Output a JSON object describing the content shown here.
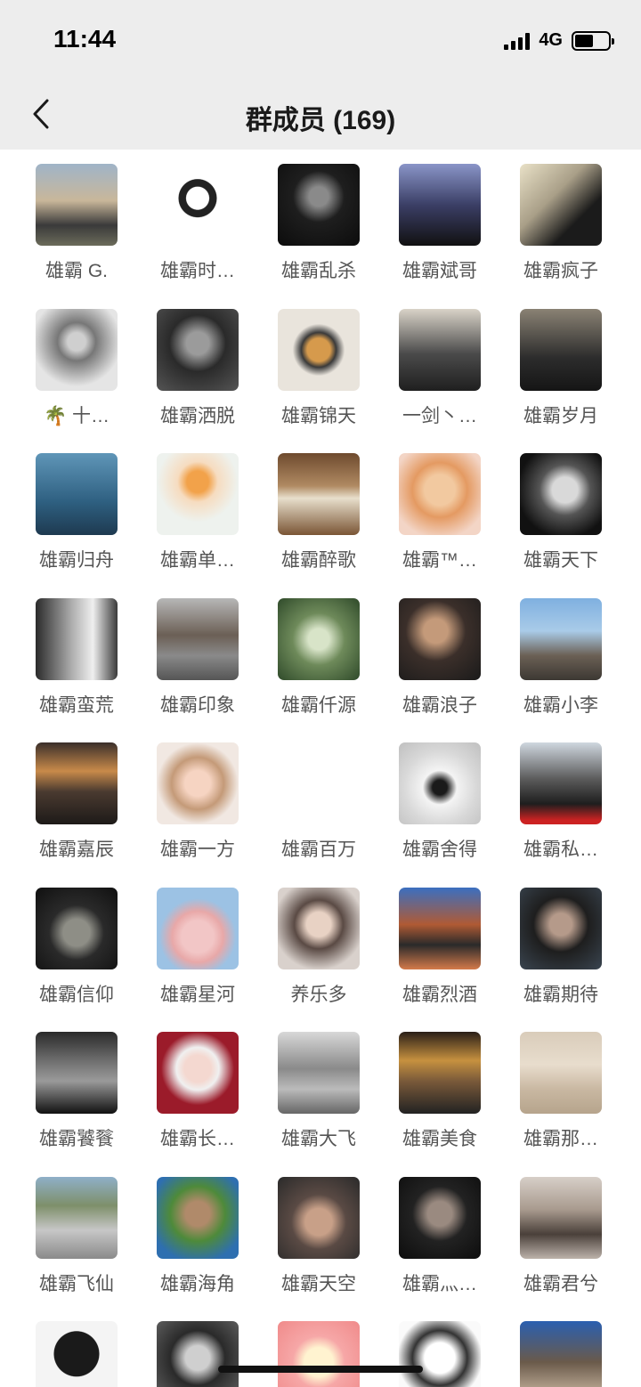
{
  "status_bar": {
    "time": "11:44",
    "network": "4G",
    "battery_level": 0.55
  },
  "nav": {
    "title": "群成员 (169)",
    "back_icon": "chevron-left-icon"
  },
  "members": [
    {
      "name": "雄霸 G.",
      "bg": "linear-gradient(180deg,#9fb4c8 0%,#c9b79a 45%,#3a3a3a 75%,#6b6b5a 100%)"
    },
    {
      "name": "雄霸时…",
      "bg": "radial-gradient(circle at 50% 42%,#ffffff 0 18%,#222 19% 30%,#fff 31%)"
    },
    {
      "name": "雄霸乱杀",
      "bg": "radial-gradient(circle at 50% 40%,#8a8a8a 0 15%,#1e1e1e 40%,#0c0c0c 100%)"
    },
    {
      "name": "雄霸斌哥",
      "bg": "linear-gradient(180deg,#8a95c8 0%,#3b3f66 50%,#111 100%)"
    },
    {
      "name": "雄霸疯子",
      "bg": "linear-gradient(135deg,#e9e1c7 0%,#a99f88 40%,#1b1b1b 70%)"
    },
    {
      "name": "🌴 十…",
      "bg": "radial-gradient(circle at 50% 40%,#cfcfcf 0 14%,#777 30%,#e5e5e5 70%)"
    },
    {
      "name": "雄霸洒脱",
      "bg": "radial-gradient(circle at 50% 42%,#9b9b9b 0 18%,#2a2a2a 45%,#555 100%)"
    },
    {
      "name": "雄霸锦天",
      "bg": "radial-gradient(circle at 50% 50%,#d69a4c 0 20%,#3a3a3a 30%,#e9e4dc 45%)"
    },
    {
      "name": "一剑丶…",
      "bg": "linear-gradient(180deg,#d9d3c8 0%,#4a4a4a 55%,#1f1f1f 100%)"
    },
    {
      "name": "雄霸岁月",
      "bg": "linear-gradient(180deg,#8a8274 0%,#2c2c2c 60%,#151515 100%)"
    },
    {
      "name": "雄霸归舟",
      "bg": "linear-gradient(180deg,#5f96b8 0%,#2e5f80 60%,#1e3a50 100%)"
    },
    {
      "name": "雄霸单…",
      "bg": "radial-gradient(circle at 50% 35%,#f2a24a 0 16%,#f6dcc0 30%,#eef2ee 60%)"
    },
    {
      "name": "雄霸醉歌",
      "bg": "linear-gradient(180deg,#6e4a2e 0%,#b08a62 40%,#e8dfcc 55%,#7a5535 100%)"
    },
    {
      "name": "雄霸™…",
      "bg": "radial-gradient(circle at 50% 45%,#f2c9a0 0 25%,#e49a62 45%,#f3d5c6 80%)"
    },
    {
      "name": "雄霸天下",
      "bg": "radial-gradient(circle at 55% 45%,#d9d9d9 0 20%,#555 40%,#111 75%)"
    },
    {
      "name": "雄霸蛮荒",
      "bg": "linear-gradient(90deg,#2a2a2a 0%,#b0b0b0 45%,#efefef 70%,#3a3a3a 100%)"
    },
    {
      "name": "雄霸印象",
      "bg": "linear-gradient(180deg,#b7b7b7 0%,#6b5f55 45%,#8a8a8a 70%,#555 100%)"
    },
    {
      "name": "雄霸仟源",
      "bg": "radial-gradient(circle at 50% 50%,#d8e4c8 0 18%,#6e8a5a 45%,#2f4a2a 100%)"
    },
    {
      "name": "雄霸浪子",
      "bg": "radial-gradient(circle at 45% 40%,#c49a7a 0 18%,#3b2f2a 45%,#1a1a1a 100%)"
    },
    {
      "name": "雄霸小李",
      "bg": "linear-gradient(180deg,#7fb0e0 0%,#a9cbe8 40%,#6b6055 70%,#3c3833 100%)"
    },
    {
      "name": "雄霸嘉辰",
      "bg": "linear-gradient(180deg,#3a2f2a 0%,#c88a4a 35%,#4a3a30 60%,#1d1a18 100%)"
    },
    {
      "name": "雄霸一方",
      "bg": "radial-gradient(circle at 50% 50%,#f6d4c2 0 22%,#c49a78 45%,#f1e8e2 70%)"
    },
    {
      "name": "雄霸百万",
      "bg": "#ffffff"
    },
    {
      "name": "雄霸舍得",
      "bg": "radial-gradient(circle at 50% 55%,#1a1a1a 0 12%,#f4f4f4 28%,#d8d8d8 60%,#bfbfbf 100%)"
    },
    {
      "name": "雄霸私…",
      "bg": "linear-gradient(180deg,#cfd7df 0%,#5a5a5a 45%,#1e1e1e 75%,#c22 95%)"
    },
    {
      "name": "雄霸信仰",
      "bg": "radial-gradient(circle at 50% 55%,#8e8e86 0 22%,#2a2a2a 45%,#101010 100%)"
    },
    {
      "name": "雄霸星河",
      "bg": "radial-gradient(circle at 50% 60%,#f2c6c6 0 25%,#e8a8a8 40%,#9cc2e4 60%)"
    },
    {
      "name": "养乐多",
      "bg": "radial-gradient(circle at 50% 45%,#e8d2c4 0 20%,#5a4a44 40%,#d9d1cc 75%)"
    },
    {
      "name": "雄霸烈酒",
      "bg": "linear-gradient(180deg,#3b6fc0 0%,#b05a34 45%,#2a2a2a 70%,#d47a4a 100%)"
    },
    {
      "name": "雄霸期待",
      "bg": "radial-gradient(circle at 50% 45%,#b59a8a 0 18%,#1e1e1e 45%,#3a4550 100%)"
    },
    {
      "name": "雄霸饕餮",
      "bg": "linear-gradient(180deg,#2a2a2a 0%,#777 40%,#9a9a9a 60%,#111 100%)"
    },
    {
      "name": "雄霸长…",
      "bg": "radial-gradient(circle at 50% 45%,#f4d8d0 0 22%,#f0f0f0 35%,#9b1b2a 60%)"
    },
    {
      "name": "雄霸大飞",
      "bg": "linear-gradient(180deg,#d8d8d8 0%,#8a8a8a 45%,#bbb 70%,#666 100%)"
    },
    {
      "name": "雄霸美食",
      "bg": "linear-gradient(180deg,#2a1f18 0%,#c6913f 35%,#7a5a3a 60%,#222 100%)"
    },
    {
      "name": "雄霸那…",
      "bg": "linear-gradient(180deg,#d9ccba 0%,#e8ddcd 40%,#c9b8a2 70%,#b6a48c 100%)"
    },
    {
      "name": "雄霸飞仙",
      "bg": "linear-gradient(180deg,#8fb0c8 0%,#7e8f6a 35%,#c7c7c7 65%,#8a8a8a 100%)"
    },
    {
      "name": "雄霸海角",
      "bg": "radial-gradient(circle at 50% 45%,#b08a6a 0 20%,#4e8a3a 45%,#2e6fb0 80%)"
    },
    {
      "name": "雄霸天空",
      "bg": "radial-gradient(circle at 50% 55%,#c8a088 0 22%,#5a4a44 45%,#2a2a2a 100%)"
    },
    {
      "name": "雄霸灬…",
      "bg": "radial-gradient(circle at 50% 45%,#9a8a80 0 20%,#222 45%,#0d0d0d 100%)"
    },
    {
      "name": "雄霸君兮",
      "bg": "linear-gradient(180deg,#d7cfc8 0%,#a89a8e 40%,#4a403a 70%,#bcb2aa 100%)"
    },
    {
      "name": "",
      "bg": "radial-gradient(circle at 50% 40%,#1a1a1a 0 35%,#f4f4f4 36%)"
    },
    {
      "name": "",
      "bg": "radial-gradient(circle at 50% 45%,#cfcfcf 0 20%,#2a2a2a 45%,#666 100%)"
    },
    {
      "name": "",
      "bg": "radial-gradient(circle at 50% 50%,#fff3d0 0 25%,#f6a7a7 45%,#f08a8a 100%)"
    },
    {
      "name": "",
      "bg": "radial-gradient(circle at 50% 45%,#ffffff 0 25%,#333 45%,#fafafa 70%)"
    },
    {
      "name": "",
      "bg": "linear-gradient(180deg,#2a5fb0 0%,#6a5a4a 50%,#d9c6b0 100%)"
    }
  ]
}
